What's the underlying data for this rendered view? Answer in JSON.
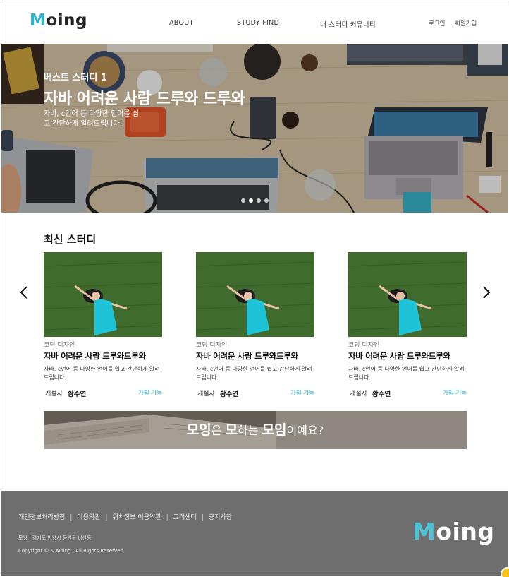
{
  "header": {
    "logo_first": "M",
    "logo_rest": "oing",
    "nav": [
      "ABOUT",
      "STUDY FIND",
      "내 스터디 커뮤니티"
    ],
    "login": "로그인",
    "signup": "회원가입"
  },
  "hero": {
    "subtitle": "베스트 스터디 1",
    "title": "자바 어려운 사람 드루와 드루와",
    "description": "자바, c언어 등 다양한 언어를 쉽고 간단하게 알려드립니다!",
    "slide_count": 4,
    "active_slide": 2
  },
  "latest": {
    "title": "최신 스터디",
    "prev_icon": "chevron-left-icon",
    "next_icon": "chevron-right-icon",
    "cards": [
      {
        "category": "코딩 디자인",
        "title": "자바 어려운 사람 드루와드루와",
        "description": "자바, c언어 등 다양한 언어를 쉽고 간단하게 알려드립니다.",
        "owner_label": "개설자",
        "owner": "황수연",
        "status": "가입 가능"
      },
      {
        "category": "코딩 디자인",
        "title": "자바 어려운 사람 드루와드루와",
        "description": "자바, c언어 등 다양한 언어를 쉽고 간단하게 알려드립니다.",
        "owner_label": "개설자",
        "owner": "황수연",
        "status": "가입 가능"
      },
      {
        "category": "코딩 디자인",
        "title": "자바 어려운 사람 드루와드루와",
        "description": "자바, c언어 등 다양한 언어를 쉽고 간단하게 알려드립니다.",
        "owner_label": "개설자",
        "owner": "황수연",
        "status": "가입 가능"
      }
    ]
  },
  "banner": {
    "part1": "모잉",
    "part2": "은 ",
    "part3": "모",
    "part4": "하는 ",
    "part5": "모임",
    "part6": "이예요?"
  },
  "footer": {
    "links": [
      "개인정보처리방침",
      "이용약관",
      "위치정보 이용약관",
      "고객센터",
      "공지사항"
    ],
    "address": "모잉 | 경기도 안양시 동안구 비산동",
    "copyright": "Copyright © & Moing . All Rights Reserved",
    "logo_first": "M",
    "logo_rest": "oing"
  },
  "colors": {
    "accent": "#2fb3c8",
    "footer_bg": "#6e6e6e"
  }
}
